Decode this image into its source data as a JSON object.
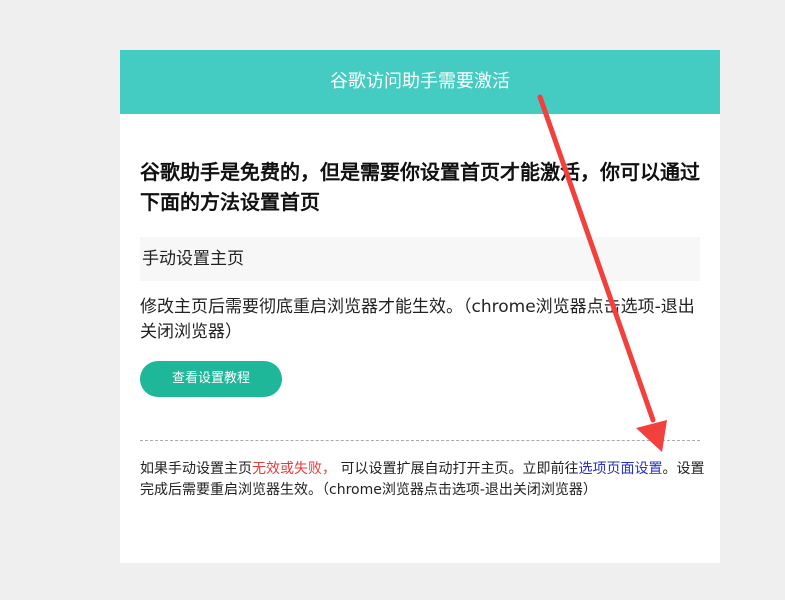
{
  "header": {
    "title": "谷歌访问助手需要激活"
  },
  "main": {
    "headline": "谷歌助手是免费的，但是需要你设置首页才能激活，你可以通过下面的方法设置首页",
    "section_title": "手动设置主页",
    "description": "修改主页后需要彻底重启浏览器才能生效。（chrome浏览器点击选项-退出关闭浏览器）",
    "tutorial_button_label": "查看设置教程"
  },
  "footer": {
    "note_prefix": "如果手动设置主页",
    "note_warning": "无效或失败，",
    "note_middle": " 可以设置扩展自动打开主页。立即前往",
    "note_link": "选项页面设置",
    "note_suffix": "。设置完成后需要重启浏览器生效。（chrome浏览器点击选项-退出关闭浏览器）"
  },
  "colors": {
    "header_bg": "#45ccc2",
    "button_bg": "#1fb79a",
    "warning_text": "#e63b3b",
    "link_text": "#2530c4",
    "annotation_arrow": "#f2403d"
  },
  "annotation": {
    "icon": "red-arrow-icon"
  }
}
